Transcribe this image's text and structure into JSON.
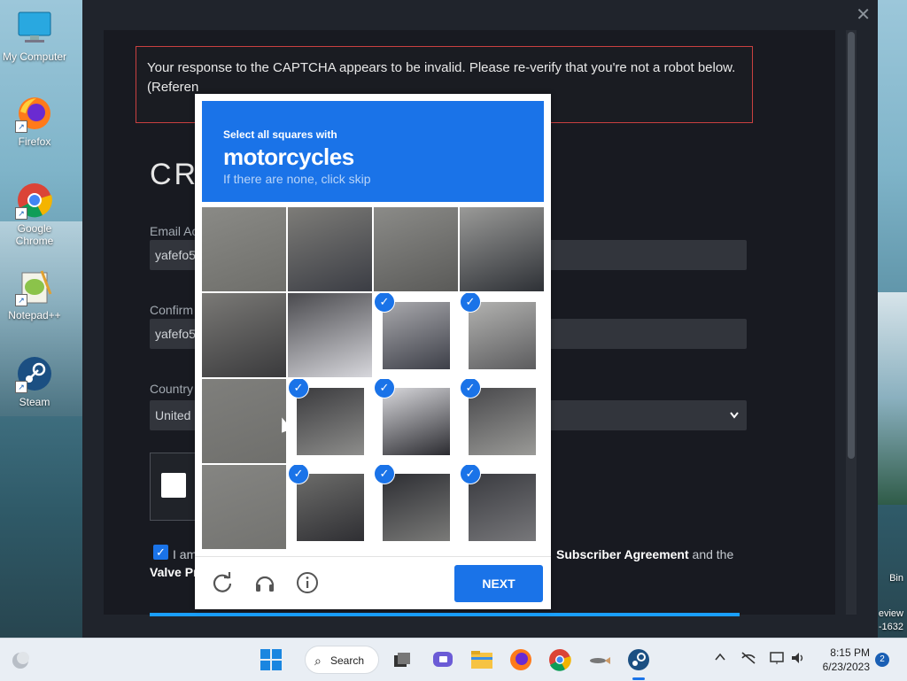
{
  "desktop": {
    "icons": [
      {
        "label": "My Computer",
        "icon": "computer-icon"
      },
      {
        "label": "Firefox",
        "icon": "firefox-icon"
      },
      {
        "label": "Google Chrome",
        "icon": "chrome-icon"
      },
      {
        "label": "Notepad++",
        "icon": "notepadpp-icon"
      },
      {
        "label": "Steam",
        "icon": "steam-icon"
      }
    ],
    "side_texts": [
      "Bin",
      "eview",
      "-1632"
    ]
  },
  "steam": {
    "close_symbol": "✕",
    "error_message": "Your response to the CAPTCHA appears to be invalid. Please re-verify that you're not a robot below.",
    "error_reference": "(Referen",
    "title": "CR",
    "email_label": "Email Ac",
    "email_value": "yafefo5",
    "confirm_label": "Confirm",
    "confirm_value": "yafefo5",
    "country_label": "Country",
    "country_value": "United",
    "agree_prefix": "I am",
    "agree_link": "Subscriber Agreement",
    "agree_suffix": " and the",
    "valve_text": "Valve Pr"
  },
  "captcha": {
    "instruction_small": "Select all squares with",
    "target": "motorcycles",
    "hint": "If there are none, click skip",
    "tiles": [
      {
        "selected": false,
        "colors": [
          "#8a8a86",
          "#6e6e6a"
        ]
      },
      {
        "selected": false,
        "colors": [
          "#7d7c78",
          "#3b3d44"
        ]
      },
      {
        "selected": false,
        "colors": [
          "#8b8b88",
          "#5a5a58"
        ]
      },
      {
        "selected": false,
        "colors": [
          "#9a9a98",
          "#2e3136"
        ]
      },
      {
        "selected": false,
        "colors": [
          "#7a7976",
          "#3a3a3c"
        ]
      },
      {
        "selected": false,
        "colors": [
          "#4a4a4e",
          "#d7d7dc"
        ]
      },
      {
        "selected": true,
        "colors": [
          "#a9a9ad",
          "#3d3f48"
        ]
      },
      {
        "selected": true,
        "colors": [
          "#b2b2b0",
          "#5c5c5e"
        ]
      },
      {
        "selected": false,
        "colors": [
          "#7f7f7c",
          "#6f6f6c"
        ]
      },
      {
        "selected": true,
        "colors": [
          "#3b3b3e",
          "#8d8d8b"
        ]
      },
      {
        "selected": true,
        "colors": [
          "#d8d8dc",
          "#2b2b30"
        ]
      },
      {
        "selected": true,
        "colors": [
          "#49494c",
          "#9a9a97"
        ]
      },
      {
        "selected": false,
        "colors": [
          "#858582",
          "#737370"
        ]
      },
      {
        "selected": true,
        "colors": [
          "#6c6c6a",
          "#2f2f33"
        ]
      },
      {
        "selected": true,
        "colors": [
          "#2d2e33",
          "#7a7a78"
        ]
      },
      {
        "selected": true,
        "colors": [
          "#3a3b40",
          "#77777a"
        ]
      }
    ],
    "next_label": "NEXT",
    "accent": "#1a73e8"
  },
  "taskbar": {
    "search_label": "Search",
    "time": "8:15 PM",
    "date": "6/23/2023",
    "notification_count": "2"
  }
}
